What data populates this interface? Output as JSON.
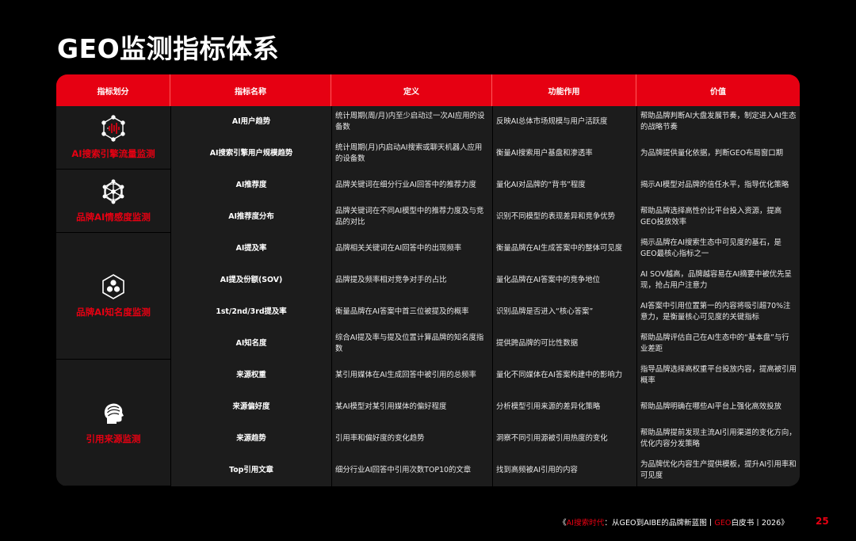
{
  "page": {
    "title": "GEO监测指标体系",
    "footer_prefix": "《",
    "footer_red1": "AI搜索时代",
    "footer_mid": "：从GEO到AIBE的品牌新蓝图丨",
    "footer_red2": "GEO",
    "footer_suffix": "白皮书丨2026》",
    "page_number": "25"
  },
  "colors": {
    "accent": "#e60012",
    "background": "#000000",
    "cell": "#1c1c1c"
  },
  "table": {
    "headers": [
      "指标划分",
      "指标名称",
      "定义",
      "功能作用",
      "价值"
    ],
    "categories": [
      {
        "label": "AI搜索引擎流量监测",
        "icon": "network-wave-icon"
      },
      {
        "label": "品牌AI情感度监测",
        "icon": "mesh-sphere-icon"
      },
      {
        "label": "品牌AI知名度监测",
        "icon": "hexagon-cluster-icon"
      },
      {
        "label": "引用来源监测",
        "icon": "head-profile-icon"
      }
    ],
    "rows": [
      {
        "name": "AI用户趋势",
        "definition": "统计周期(周/月)内至少启动过一次AI应用的设备数",
        "function": "反映AI总体市场规模与用户活跃度",
        "value": "帮助品牌判断AI大盘发展节奏，制定进入AI生态的战略节奏"
      },
      {
        "name": "AI搜索引擎用户规模趋势",
        "definition": "统计周期(月)内启动AI搜索或聊天机器人应用的设备数",
        "function": "衡量AI搜索用户基盘和渗透率",
        "value": "为品牌提供量化依据，判断GEO布局窗口期"
      },
      {
        "name": "AI推荐度",
        "definition": "品牌关键词在细分行业AI回答中的推荐力度",
        "function": "量化AI对品牌的“背书”程度",
        "value": "揭示AI模型对品牌的信任水平，指导优化策略"
      },
      {
        "name": "AI推荐度分布",
        "definition": "品牌关键词在不同AI模型中的推荐力度及与竞品的对比",
        "function": "识别不同模型的表现差异和竞争优势",
        "value": "帮助品牌选择高性价比平台投入资源，提高GEO投放效率"
      },
      {
        "name": "AI提及率",
        "definition": "品牌相关关键词在AI回答中的出现频率",
        "function": "衡量品牌在AI生成答案中的整体可见度",
        "value": "揭示品牌在AI搜索生态中可见度的基石，是GEO最核心指标之一"
      },
      {
        "name": "AI提及份额(SOV)",
        "definition": "品牌提及频率相对竞争对手的占比",
        "function": "量化品牌在AI答案中的竞争地位",
        "value": "AI SOV越高，品牌越容易在AI摘要中被优先呈现，抢占用户注意力"
      },
      {
        "name": "1st/2nd/3rd提及率",
        "definition": "衡量品牌在AI答案中首三位被提及的概率",
        "function": "识别品牌是否进入“核心答案”",
        "value": "AI答案中引用位置第一的内容将吸引超70%注意力，是衡量核心可见度的关键指标"
      },
      {
        "name": "AI知名度",
        "definition": "综合AI提及率与提及位置计算品牌的知名度指数",
        "function": "提供跨品牌的可比性数据",
        "value": "帮助品牌评估自己在AI生态中的“基本盘”与行业差距"
      },
      {
        "name": "来源权重",
        "definition": "某引用媒体在AI生成回答中被引用的总频率",
        "function": "量化不同媒体在AI答案构建中的影响力",
        "value": "指导品牌选择高权重平台投放内容，提高被引用概率"
      },
      {
        "name": "来源偏好度",
        "definition": "某AI模型对某引用媒体的偏好程度",
        "function": "分析模型引用来源的差异化策略",
        "value": "帮助品牌明确在哪些AI平台上强化高效投放"
      },
      {
        "name": "来源趋势",
        "definition": "引用率和偏好度的变化趋势",
        "function": "洞察不同引用源被引用热度的变化",
        "value": "帮助品牌提前发现主流AI引用渠道的变化方向，优化内容分发策略"
      },
      {
        "name": "Top引用文章",
        "definition": "细分行业AI回答中引用次数TOP10的文章",
        "function": "找到高频被AI引用的内容",
        "value": "为品牌优化内容生产提供模板，提升AI引用率和可见度"
      }
    ]
  }
}
